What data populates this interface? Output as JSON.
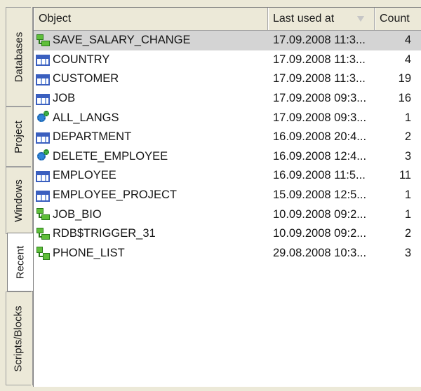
{
  "tabs": [
    {
      "label": "Databases",
      "active": false
    },
    {
      "label": "Project",
      "active": false
    },
    {
      "label": "Windows",
      "active": false
    },
    {
      "label": "Recent",
      "active": true
    },
    {
      "label": "Scripts/Blocks",
      "active": false
    }
  ],
  "columns": {
    "object": "Object",
    "last_used": "Last used at",
    "count": "Count"
  },
  "rows": [
    {
      "name": "SAVE_SALARY_CHANGE",
      "icon": "trigger-icon",
      "last_used": "17.09.2008 11:3...",
      "count": "4",
      "selected": true
    },
    {
      "name": "COUNTRY",
      "icon": "table-icon",
      "last_used": "17.09.2008 11:3...",
      "count": "4"
    },
    {
      "name": "CUSTOMER",
      "icon": "table-icon",
      "last_used": "17.09.2008 11:3...",
      "count": "19"
    },
    {
      "name": "JOB",
      "icon": "table-icon",
      "last_used": "17.09.2008 09:3...",
      "count": "16"
    },
    {
      "name": "ALL_LANGS",
      "icon": "procedure-icon",
      "last_used": "17.09.2008 09:3...",
      "count": "1"
    },
    {
      "name": "DEPARTMENT",
      "icon": "table-icon",
      "last_used": "16.09.2008 20:4...",
      "count": "2"
    },
    {
      "name": "DELETE_EMPLOYEE",
      "icon": "procedure-icon",
      "last_used": "16.09.2008 12:4...",
      "count": "3"
    },
    {
      "name": "EMPLOYEE",
      "icon": "table-icon",
      "last_used": "16.09.2008 11:5...",
      "count": "11"
    },
    {
      "name": "EMPLOYEE_PROJECT",
      "icon": "table-icon",
      "last_used": "15.09.2008 12:5...",
      "count": "1"
    },
    {
      "name": "JOB_BIO",
      "icon": "trigger-icon",
      "last_used": "10.09.2008 09:2...",
      "count": "1"
    },
    {
      "name": "RDB$TRIGGER_31",
      "icon": "trigger-icon",
      "last_used": "10.09.2008 09:2...",
      "count": "2"
    },
    {
      "name": "PHONE_LIST",
      "icon": "view-icon",
      "last_used": "29.08.2008 10:3...",
      "count": "3"
    }
  ]
}
